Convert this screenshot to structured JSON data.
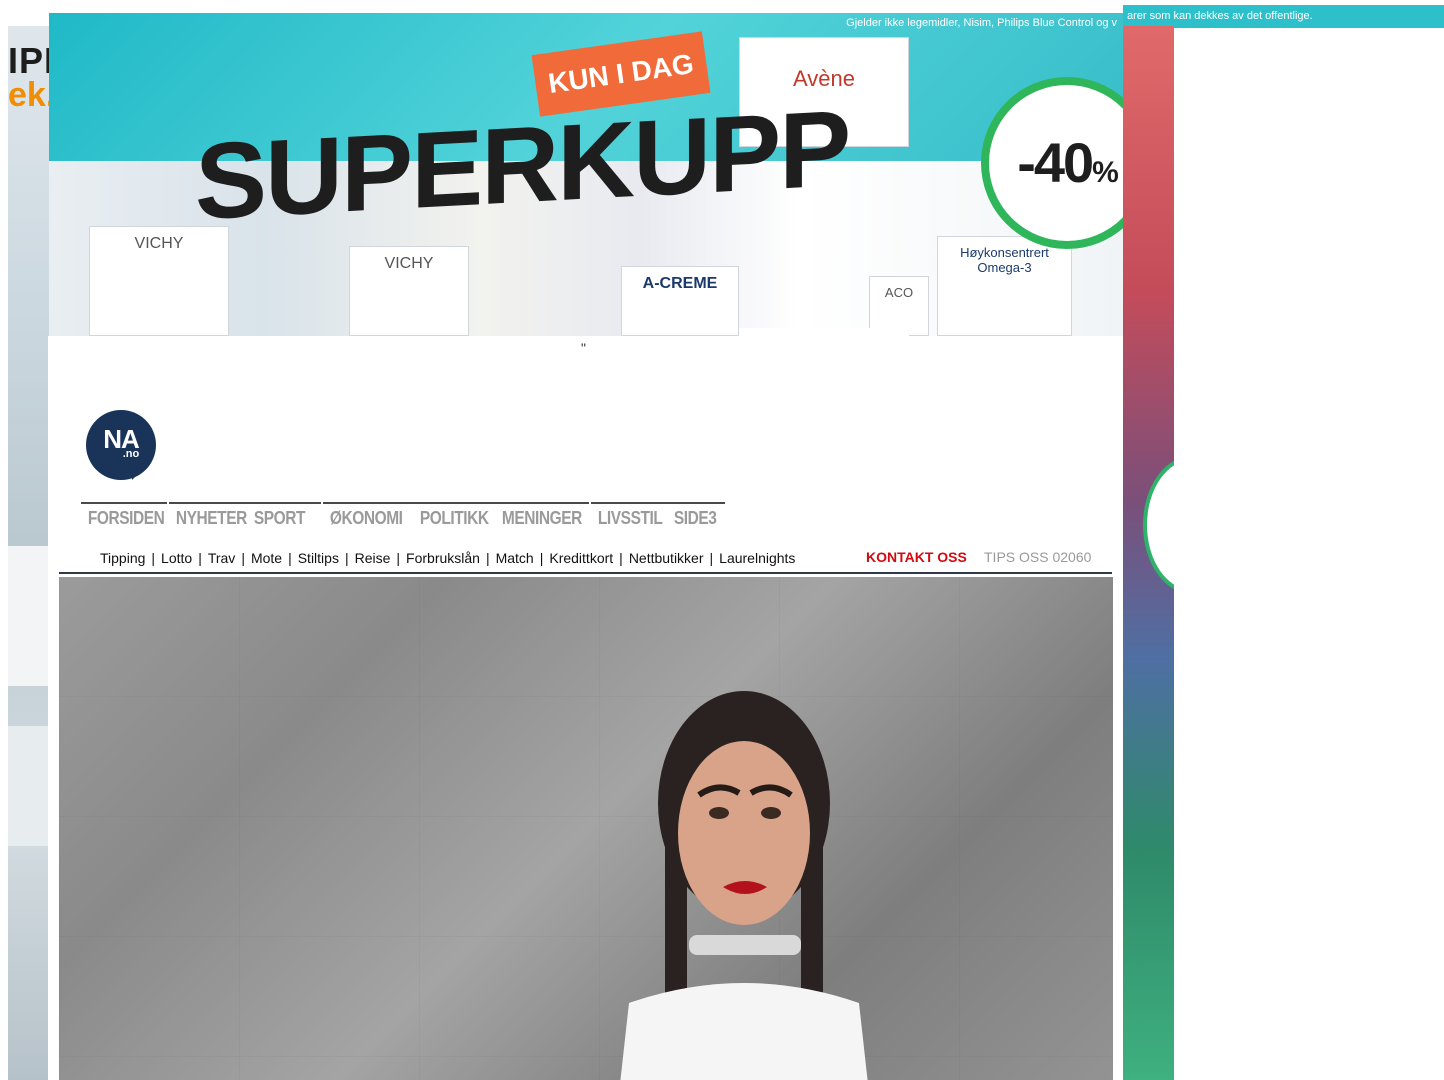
{
  "ad": {
    "top_disclaimer": "Gjelder ikke legemidler, Nisim, Philips Blue Control og v",
    "right_strip_text": "arer som kan dekkes av det offentlige.",
    "brand_line1": "IPLETT",
    "brand_line2": "ek.no",
    "kun_i_dag": "KUN I DAG",
    "headline": "SUPERKUPP",
    "discount": "-40",
    "discount_unit": "%",
    "products": [
      "VICHY",
      "VICHY",
      "A-CREME",
      "Høykonsentrert Omega-3",
      "ACO",
      "Avène"
    ]
  },
  "page": {
    "stray_mark": "\"",
    "logo_text": "NA",
    "logo_sub": ".no",
    "main_nav": [
      [
        "FORSIDEN"
      ],
      [
        "NYHETER",
        "SPORT"
      ],
      [
        "ØKONOMI",
        "POLITIKK",
        "MENINGER"
      ],
      [
        "LIVSSTIL",
        "SIDE3"
      ]
    ],
    "sub_nav": [
      "Tipping",
      "Lotto",
      "Trav",
      "Mote",
      "Stiltips",
      "Reise",
      "Forbrukslån",
      "Match",
      "Kredittkort",
      "Nettbutikker",
      "Laurelnights"
    ],
    "contact_label": "KONTAKT OSS",
    "tips_label": "TIPS OSS 02060"
  }
}
